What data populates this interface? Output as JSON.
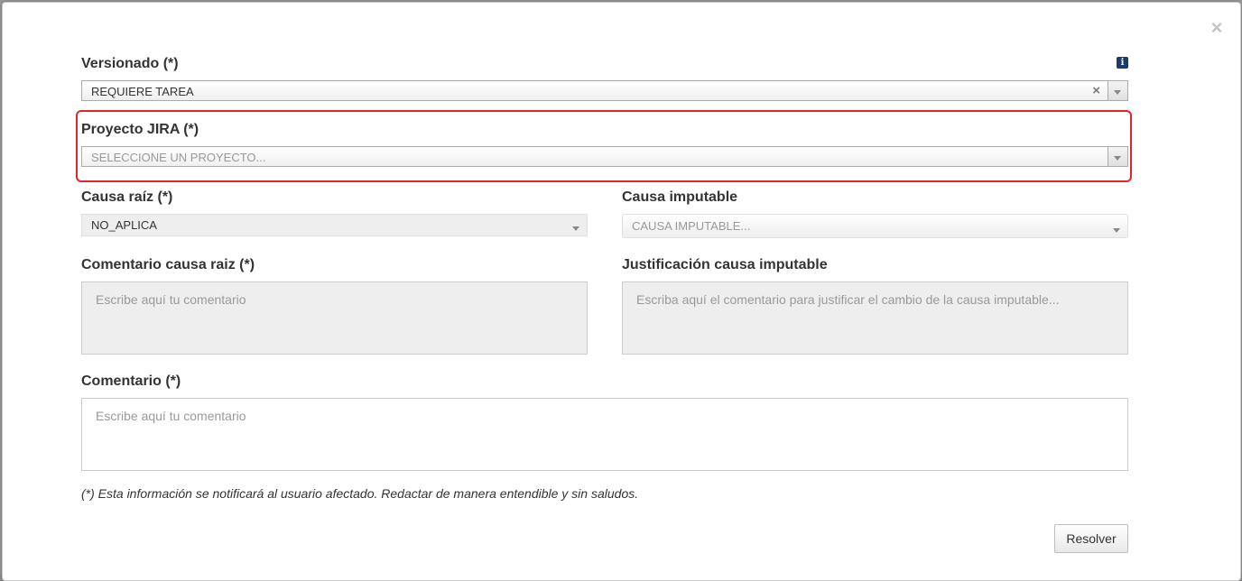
{
  "dialog": {
    "close_glyph": "×",
    "info_glyph": "i",
    "versionado": {
      "label": "Versionado (*)",
      "value": "REQUIERE TAREA",
      "clear_glyph": "×"
    },
    "proyecto_jira": {
      "label": "Proyecto JIRA (*)",
      "placeholder": "SELECCIONE UN PROYECTO..."
    },
    "causa_raiz": {
      "label": "Causa raíz (*)",
      "value": "NO_APLICA"
    },
    "causa_imputable": {
      "label": "Causa imputable",
      "placeholder": "CAUSA IMPUTABLE..."
    },
    "comentario_causa_raiz": {
      "label": "Comentario causa raiz (*)",
      "placeholder": "Escribe aquí tu comentario"
    },
    "justificacion_causa_imputable": {
      "label": "Justificación causa imputable",
      "placeholder": "Escriba aquí el comentario para justificar el cambio de la causa imputable..."
    },
    "comentario": {
      "label": "Comentario (*)",
      "placeholder": "Escribe aquí tu comentario"
    },
    "note": "(*) Esta información se notificará al usuario afectado. Redactar de manera entendible y sin saludos.",
    "resolver_button": "Resolver"
  },
  "colors": {
    "highlight": "#e3242b",
    "info_icon": "#1a3b6e"
  },
  "icons": [
    "close-icon",
    "info-icon",
    "clear-icon",
    "chevron-down-icon"
  ]
}
